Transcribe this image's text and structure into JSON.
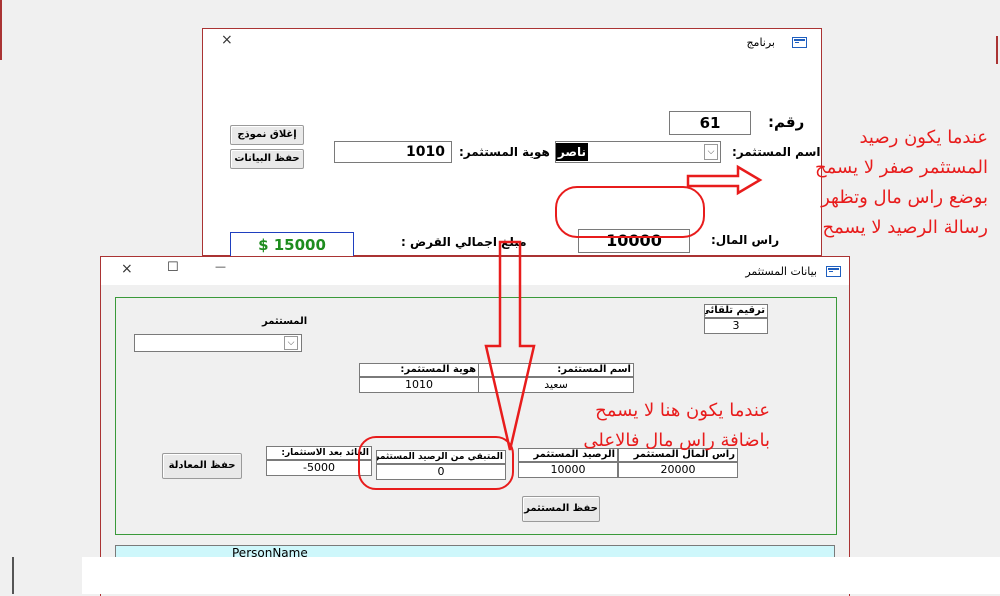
{
  "top_window": {
    "title": "برنامج",
    "close_glyph": "×",
    "raqam_label": "رقم:",
    "raqam_value": "61",
    "investor_name_label": "اسم المستثمر:",
    "investor_name_value": "ناصر",
    "investor_id_label": "هوية المستثمر:",
    "investor_id_value": "1010",
    "capital_label": "راس المال:",
    "capital_value": "10000",
    "loan_total_label": "مبلغ اجمالي القرض :",
    "loan_total_value": "$ 15000",
    "close_form_button": "إغلاق نموذج",
    "save_data_button": "حفظ البيانات"
  },
  "bottom_window": {
    "title": "بيانات المستثمر",
    "minimize_glyph": "—",
    "maximize_glyph": "☐",
    "close_glyph": "×",
    "auto_number_label": "ترقيم تلقائي:",
    "auto_number_value": "3",
    "investor_combo_label": "المستثمر",
    "investor_combo_value": "",
    "investor_id_label": "هوية المستثمر:",
    "investor_id_value": "1010",
    "investor_name_label": "اسم المستثمر:",
    "investor_name_value": "سعيد",
    "capital_label": "راس المال المستثمر",
    "capital_value": "20000",
    "balance_label": "الرصيد المستثمر",
    "balance_value": "10000",
    "remaining_label": "المتبقي من الرصيد المستثمر:",
    "remaining_value": "0",
    "return_label": "العائد بعد الاستثمار:",
    "return_value": "-5000",
    "save_equation_button": "حفظ المعادلة",
    "save_investor_button": "حفظ المستثمر",
    "table_header_person_name": "PersonName"
  },
  "annotations": {
    "top_note": [
      "عندما يكون رصيد",
      "المستثمر صفر لا يسمح",
      "بوضع راس مال وتظهر",
      "رسالة الرصيد لا يسمح"
    ],
    "bottom_note": [
      "عندما يكون هنا لا يسمح",
      "باضافة راس مال فالاعلى"
    ]
  },
  "colors": {
    "annotation_red": "#e81c1c",
    "window_border": "#aa3333",
    "loan_text_green": "#1e8c1e",
    "loan_box_blue": "#1f3fbf",
    "group_border_green": "#3a9a3a",
    "table_header_cyan": "#cef7fb"
  }
}
